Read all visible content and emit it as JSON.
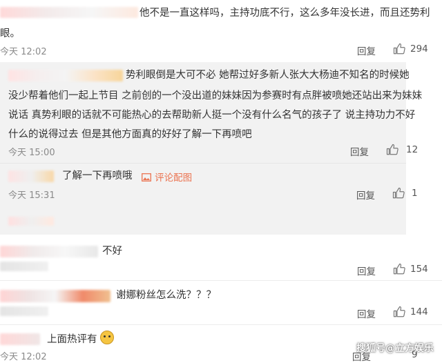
{
  "comments": [
    {
      "text_line1": "他不是一直这样吗，主持功底不行，这么多年没长进，而且还势利",
      "text_line2": "眼。",
      "time": "今天 12:02",
      "reply_label": "回复",
      "likes": "294"
    }
  ],
  "replies": [
    {
      "lines": [
        "势利眼倒是大可不必  她帮过好多新人张大大杨迪不知名的时候她",
        "没少帮着他们一起上节目 之前创的一个没出道的妹妹因为参赛时有点胖被喷她还站出来为妹妹",
        "说话  真势利眼的话就不可能热心的去帮助新人挺一个没有什么名气的孩子了 说主持功力不好",
        "什么的说得过去 但是其他方面真的好好了解一下再喷吧"
      ],
      "time": "今天 15:00",
      "reply_label": "回复",
      "likes": "12"
    },
    {
      "text": "了解一下再喷哦",
      "pic_link": "评论配图",
      "time": "今天 15:31",
      "reply_label": "回复",
      "likes": "1"
    }
  ],
  "comments2": [
    {
      "text": "不好",
      "reply_label": "回复",
      "likes": "154"
    },
    {
      "text": "谢娜粉丝怎么洗？？？",
      "reply_label": "回复",
      "likes": "144"
    },
    {
      "text": "上面热评有",
      "time": "今天 12:02",
      "reply_label": "回复",
      "likes": "9"
    }
  ],
  "watermark": "搜狐号@立方娱乐",
  "colors": {
    "reply_bg": "#f2f2f2",
    "pic_link": "#eb7350",
    "watermark": "#ffffff"
  }
}
